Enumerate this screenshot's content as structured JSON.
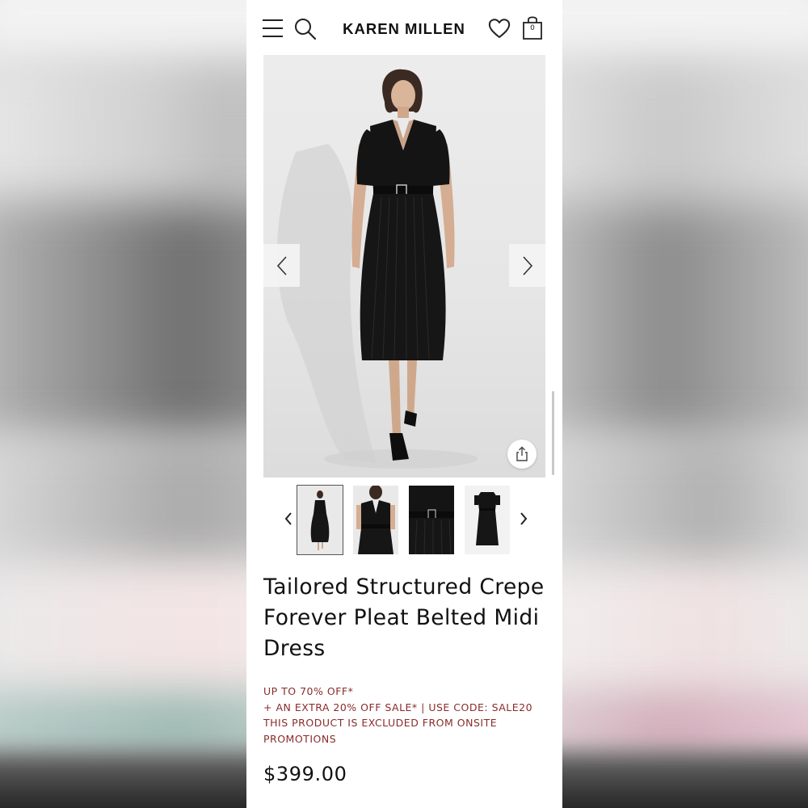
{
  "header": {
    "brand": "KAREN MILLEN",
    "bag_count": "0"
  },
  "product": {
    "title_lines": [
      "Tailored Structured Crepe",
      "Forever Pleat Belted Midi",
      "Dress"
    ],
    "promos": [
      "UP TO 70% OFF*",
      "+ AN EXTRA 20% OFF SALE* | USE CODE: SALE20",
      "THIS PRODUCT IS EXCLUDED FROM ONSITE",
      "PROMOTIONS"
    ],
    "price": "$399.00"
  },
  "gallery": {
    "thumbnail_count": 4,
    "selected_thumbnail": 1
  },
  "colors": {
    "promo_text": "#8a2b2b",
    "dress": "#111111"
  }
}
